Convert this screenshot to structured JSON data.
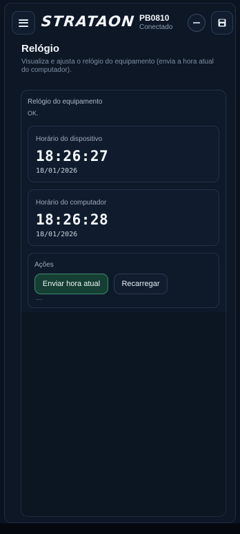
{
  "header": {
    "brand": "STRATAON",
    "device_id": "PB0810",
    "connection_status": "Conectado",
    "icons": {
      "menu": "hamburger-menu-icon",
      "minimize": "minus-circle-icon",
      "save": "floppy-disk-icon"
    }
  },
  "page": {
    "title": "Relógio",
    "description": "Visualiza e ajusta o relógio do equipamento (envia a hora atual do computador)."
  },
  "equipment_clock": {
    "label": "Relógio do equipamento",
    "status": "OK."
  },
  "device_time": {
    "label": "Horário do dispositivo",
    "time": "18:26:27",
    "date": "18/01/2026"
  },
  "computer_time": {
    "label": "Horário do computador",
    "time": "18:26:28",
    "date": "18/01/2026"
  },
  "actions": {
    "label": "Ações",
    "send_time_label": "Enviar hora atual",
    "reload_label": "Recarregar",
    "result": "—"
  },
  "colors": {
    "background": "#0b1320",
    "card": "#0e1929",
    "accent_green": "#3c8c6b",
    "text": "#e6edf6"
  }
}
